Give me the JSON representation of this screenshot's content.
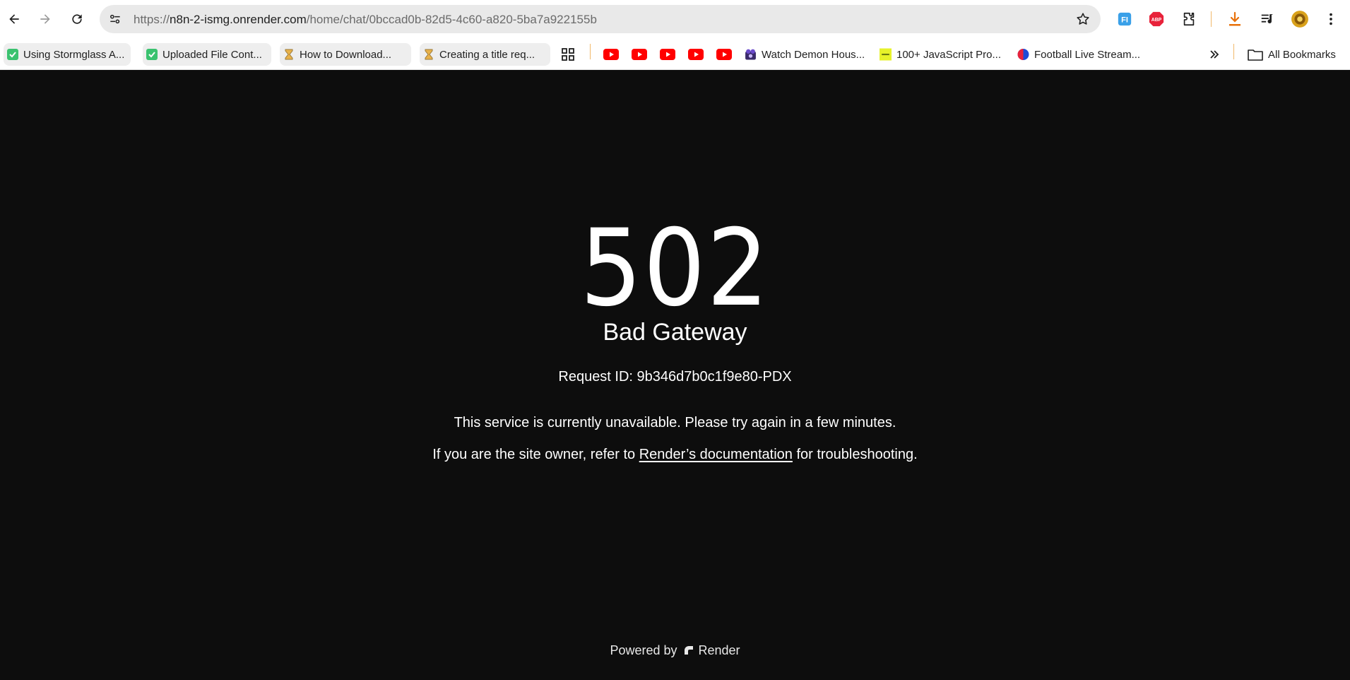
{
  "browser": {
    "url_prefix": "https://",
    "url_host": "n8n-2-ismg.onrender.com",
    "url_path": "/home/chat/0bccad0b-82d5-4c60-a820-5ba7a922155b"
  },
  "bookmarks": [
    {
      "label": "Using Stormglass A...",
      "icon": "green-check-icon"
    },
    {
      "label": "Uploaded File Cont...",
      "icon": "green-check-icon"
    },
    {
      "label": "How to Download...",
      "icon": "hourglass-icon"
    },
    {
      "label": "Creating a title req...",
      "icon": "hourglass-icon"
    },
    {
      "label": "Watch Demon Hous...",
      "icon": "film-icon"
    },
    {
      "label": "100+ JavaScript Pro...",
      "icon": "yellow-square-icon"
    },
    {
      "label": "Football Live Stream...",
      "icon": "red-blue-circle-icon"
    }
  ],
  "all_bookmarks_label": "All Bookmarks",
  "error": {
    "code": "502",
    "status": "Bad Gateway",
    "request_id": "Request ID: 9b346d7b0c1f9e80-PDX",
    "message": "This service is currently unavailable. Please try again in a few minutes.",
    "owner_prefix": "If you are the site owner, refer to ",
    "doc_link": "Render’s documentation",
    "owner_suffix": " for troubleshooting."
  },
  "footer": {
    "powered_by": "Powered by",
    "brand": "Render"
  },
  "colors": {
    "page_bg": "#0d0d0d",
    "text": "#ffffff",
    "youtube_red": "#ff0000"
  }
}
